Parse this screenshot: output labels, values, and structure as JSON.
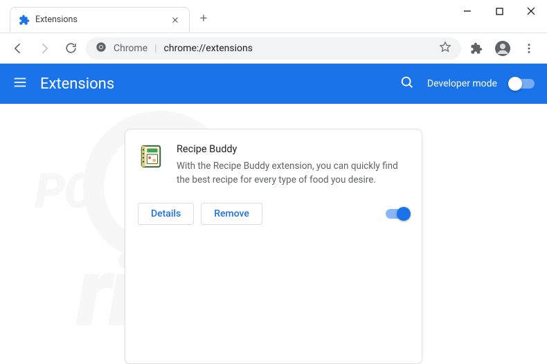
{
  "window": {
    "tab_title": "Extensions",
    "minimize": "–",
    "maximize": "□",
    "close": "×"
  },
  "toolbar": {
    "omnibox_chip": "Chrome",
    "omnibox_url": "chrome://extensions"
  },
  "header": {
    "title": "Extensions",
    "dev_mode_label": "Developer mode"
  },
  "extension": {
    "name": "Recipe Buddy",
    "description": "With the Recipe Buddy extension, you can quickly find the best recipe for every type of food you desire.",
    "details_label": "Details",
    "remove_label": "Remove",
    "enabled": true
  }
}
